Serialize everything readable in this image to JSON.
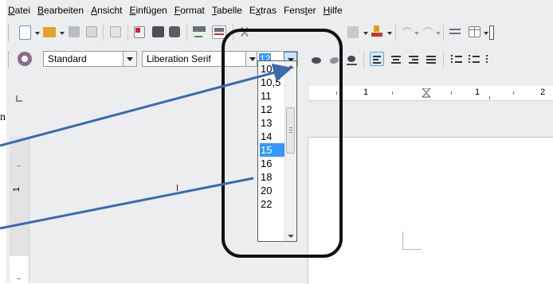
{
  "menu": [
    {
      "first": "D",
      "rest": "atei"
    },
    {
      "first": "B",
      "rest": "earbeiten"
    },
    {
      "first": "A",
      "rest": "nsicht"
    },
    {
      "first": "E",
      "rest": "infügen"
    },
    {
      "first": "F",
      "rest": "ormat"
    },
    {
      "first": "T",
      "rest": "abelle"
    },
    {
      "first": "",
      "rest": "Extras",
      "pre": "E",
      "u": "x",
      "post": "tras"
    },
    {
      "first": "",
      "rest": "Fenster",
      "pre": "Fens",
      "u": "t",
      "post": "er"
    },
    {
      "first": "H",
      "rest": "ilfe"
    }
  ],
  "formatting": {
    "paragraph_style": "Standard",
    "font_name": "Liberation Serif",
    "font_size": "12"
  },
  "font_size_list": {
    "options": [
      "10",
      "10,5",
      "11",
      "12",
      "13",
      "14",
      "15",
      "16",
      "18",
      "20",
      "22"
    ],
    "highlighted": "15",
    "current": "12"
  },
  "ruler": {
    "labels": [
      "1",
      "1",
      "2"
    ]
  },
  "vruler": {
    "labels": [
      "1"
    ]
  },
  "partial_label": "n",
  "colors": {
    "annotation_line": "#3a6ab0",
    "selection": "#3399ff",
    "frame": "#111111"
  }
}
